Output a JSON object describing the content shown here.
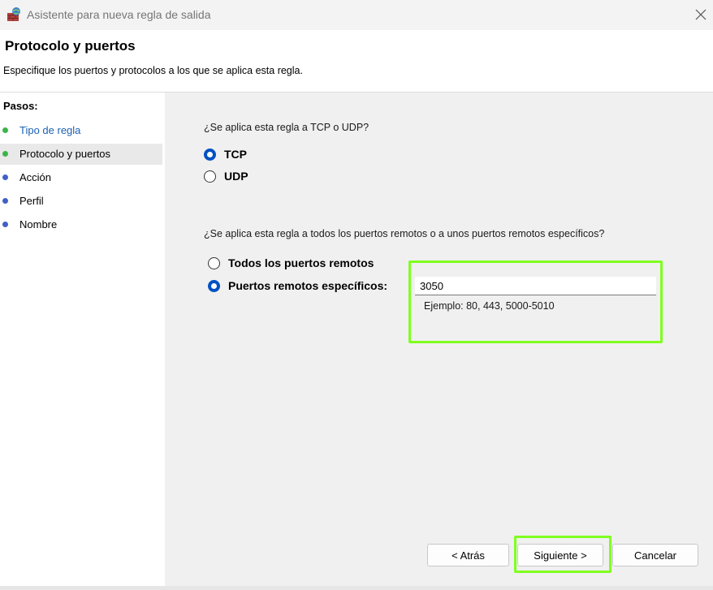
{
  "window": {
    "title": "Asistente para nueva regla de salida"
  },
  "header": {
    "title": "Protocolo y puertos",
    "description": "Especifique los puertos y protocolos a los que se aplica esta regla."
  },
  "sidebar": {
    "heading": "Pasos:",
    "steps": [
      {
        "label": "Tipo de regla",
        "state": "done",
        "dot_color": "#3bb54a"
      },
      {
        "label": "Protocolo y puertos",
        "state": "current",
        "dot_color": "#3bb54a"
      },
      {
        "label": "Acción",
        "state": "pending",
        "dot_color": "#4060c8"
      },
      {
        "label": "Perfil",
        "state": "pending",
        "dot_color": "#4060c8"
      },
      {
        "label": "Nombre",
        "state": "pending",
        "dot_color": "#4060c8"
      }
    ]
  },
  "protocol": {
    "question": "¿Se aplica esta regla a TCP o UDP?",
    "options": [
      {
        "label": "TCP",
        "selected": true
      },
      {
        "label": "UDP",
        "selected": false
      }
    ]
  },
  "ports": {
    "question": "¿Se aplica esta regla a todos los puertos remotos o a unos puertos remotos específicos?",
    "options": [
      {
        "label": "Todos los puertos remotos",
        "selected": false
      },
      {
        "label": "Puertos remotos específicos:",
        "selected": true
      }
    ],
    "value": "3050",
    "example": "Ejemplo: 80, 443, 5000-5010"
  },
  "buttons": {
    "back": "< Atrás",
    "next": "Siguiente >",
    "cancel": "Cancelar"
  },
  "colors": {
    "accent": "#0051c3",
    "highlight": "#7fff1f",
    "link": "#1a5fb4"
  }
}
